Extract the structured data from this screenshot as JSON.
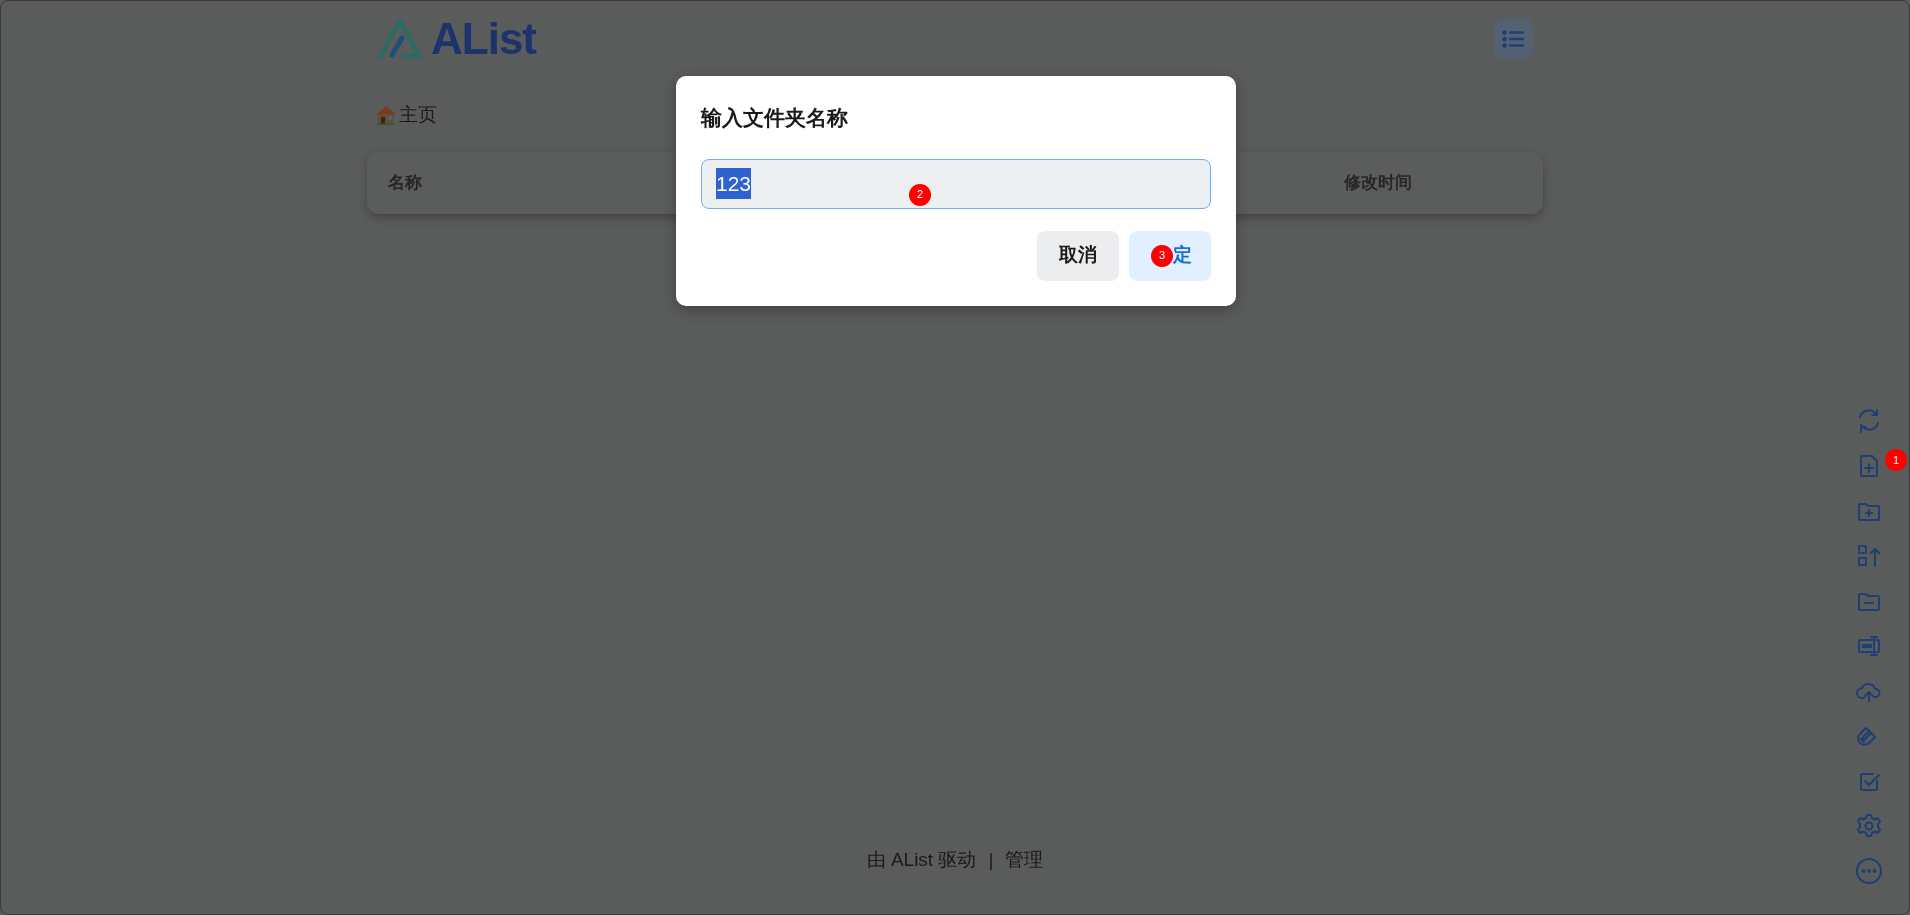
{
  "header": {
    "logo_text": "AList"
  },
  "breadcrumb": {
    "label": "主页"
  },
  "table": {
    "columns": [
      "名称",
      "修改时间"
    ]
  },
  "dialog": {
    "title": "输入文件夹名称",
    "input": {
      "value": "123",
      "selected": true
    },
    "buttons": [
      {
        "label": "取消",
        "kind": "secondary"
      },
      {
        "label": "定",
        "kind": "primary"
      }
    ]
  },
  "footer": {
    "powered_by": "由 AList 驱动",
    "separator": "|",
    "admin_link": "管理"
  },
  "annotations": [
    "1",
    "2",
    "3"
  ]
}
